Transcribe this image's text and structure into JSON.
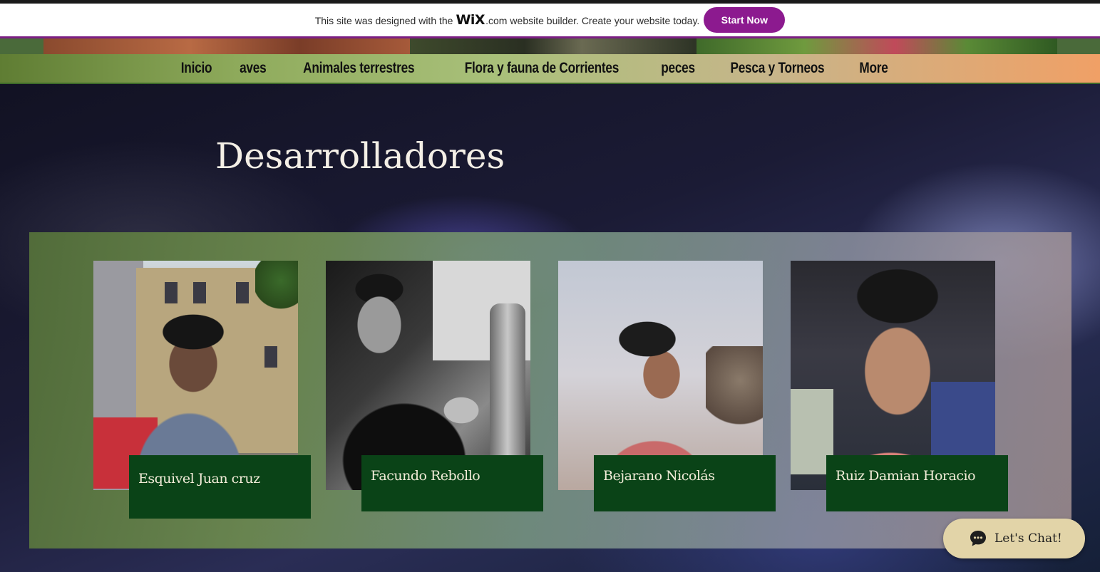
{
  "wix_banner": {
    "text_before": "This site was designed with the",
    "logo": "WiX",
    "dotcom": ".com",
    "text_after": "website builder. Create your website today.",
    "cta_label": "Start Now"
  },
  "nav": {
    "items": [
      {
        "label": "Inicio"
      },
      {
        "label": "aves"
      },
      {
        "label": "Animales terrestres"
      },
      {
        "label": "Flora y fauna de Corrientes"
      },
      {
        "label": "peces"
      },
      {
        "label": "Pesca y Torneos"
      },
      {
        "label": "More"
      }
    ]
  },
  "hero": {
    "title": "Desarrolladores"
  },
  "team": {
    "members": [
      {
        "name": "Esquivel Juan cruz"
      },
      {
        "name": "Facundo Rebollo"
      },
      {
        "name": "Bejarano Nicolás"
      },
      {
        "name": "Ruiz Damian Horacio"
      }
    ]
  },
  "chat": {
    "label": "Let's Chat!",
    "icon": "chat-bubble-icon"
  },
  "colors": {
    "wix_cta": "#8c1a8f",
    "name_box": "#0a4317",
    "chat_bg": "#e2d4a8"
  }
}
